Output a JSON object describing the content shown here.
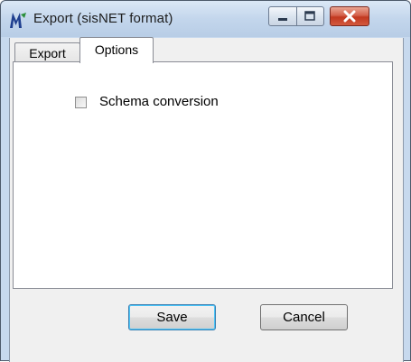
{
  "window": {
    "title": "Export (sisNET format)"
  },
  "tabs": [
    {
      "label": "Export",
      "active": false
    },
    {
      "label": "Options",
      "active": true
    }
  ],
  "options": {
    "schema_conversion_label": "Schema conversion",
    "schema_conversion_checked": false
  },
  "buttons": {
    "save_label": "Save",
    "cancel_label": "Cancel"
  },
  "icons": {
    "app": "app-logo-icon",
    "minimize": "minimize-icon",
    "maximize": "maximize-icon",
    "close": "close-icon"
  },
  "colors": {
    "titlebar": "#c3d6ec",
    "close_button": "#c2381f",
    "app_icon": "#1f3f8f",
    "default_button_highlight": "#48c4f8"
  }
}
